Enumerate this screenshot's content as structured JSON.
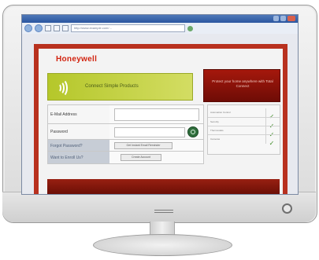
{
  "browser": {
    "address_text": "http://www.example.com/…",
    "icons": {
      "back": "back-arrow-icon",
      "forward": "forward-arrow-icon",
      "refresh": "refresh-icon",
      "go": "go-icon"
    }
  },
  "site": {
    "brand": "Honeywell",
    "banner_green_text": "Connect Simple Products",
    "banner_red_text": "Protect your home anywhere with Total Connect",
    "form": {
      "email_label": "E-Mail Address",
      "password_label": "Password",
      "forgot_label": "Forgot Password?",
      "new_user_label": "Want to Enroll Us?",
      "button_1": "Get Instant Email Reminder",
      "button_2": "Create Account"
    },
    "checklist": {
      "items": [
        "Automation Control",
        "Security",
        "Thermostats",
        "Cameras"
      ]
    }
  },
  "colors": {
    "brand_red": "#d2230f",
    "frame_red": "#b8311f",
    "green_banner": "#b5c72a",
    "check_green": "#3c8a22"
  }
}
